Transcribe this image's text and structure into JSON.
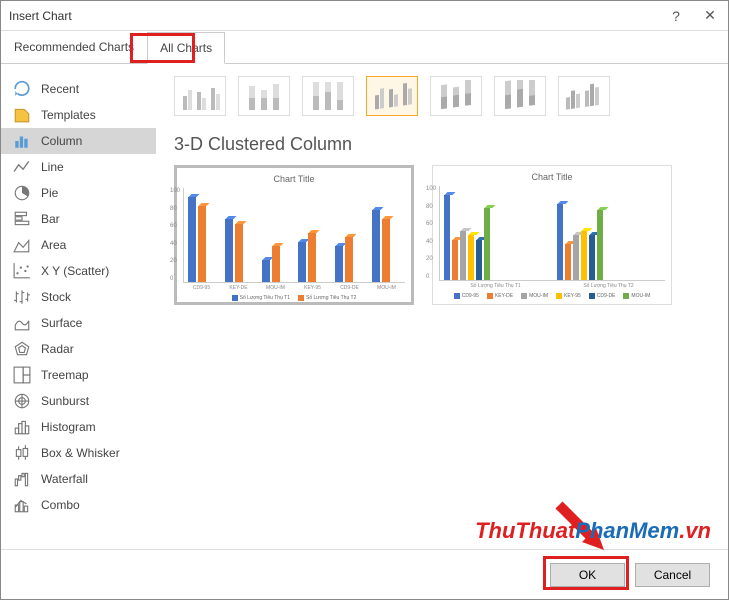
{
  "dialog": {
    "title": "Insert Chart"
  },
  "tabs": {
    "recommended": "Recommended Charts",
    "all": "All Charts"
  },
  "sidebar": {
    "items": [
      {
        "label": "Recent"
      },
      {
        "label": "Templates"
      },
      {
        "label": "Column"
      },
      {
        "label": "Line"
      },
      {
        "label": "Pie"
      },
      {
        "label": "Bar"
      },
      {
        "label": "Area"
      },
      {
        "label": "X Y (Scatter)"
      },
      {
        "label": "Stock"
      },
      {
        "label": "Surface"
      },
      {
        "label": "Radar"
      },
      {
        "label": "Treemap"
      },
      {
        "label": "Sunburst"
      },
      {
        "label": "Histogram"
      },
      {
        "label": "Box & Whisker"
      },
      {
        "label": "Waterfall"
      },
      {
        "label": "Combo"
      }
    ]
  },
  "main": {
    "chart_type_title": "3-D Clustered Column",
    "preview1_title": "Chart Title",
    "preview2_title": "Chart Title",
    "p1_categories": [
      "CD9-95",
      "KEY-DE",
      "MOU-IM",
      "KEY-95",
      "CD9-DE",
      "MOU-IM"
    ],
    "p1_legend": [
      "Số Lượng Tiêu Thụ T1",
      "Số Lượng Tiêu Thụ T2"
    ],
    "p2_categories": [
      "Số Lượng Tiêu Thụ T1",
      "Số Lượng Tiêu Thụ T2"
    ],
    "p2_legend": [
      "CD9-95",
      "KEY-DE",
      "MOU-IM",
      "KEY-95",
      "CD9-DE",
      "MOU-IM"
    ]
  },
  "footer": {
    "ok": "OK",
    "cancel": "Cancel"
  },
  "watermark": {
    "part1": "ThuThuat",
    "part2": "PhanMem",
    "part3": ".vn"
  },
  "chart_data": [
    {
      "type": "bar",
      "title": "Chart Title",
      "categories": [
        "CD9-95",
        "KEY-DE",
        "MOU-IM",
        "KEY-95",
        "CD9-DE",
        "MOU-IM"
      ],
      "series": [
        {
          "name": "Số Lượng Tiêu Thụ T1",
          "values": [
            95,
            70,
            25,
            45,
            40,
            80
          ],
          "color": "#4472c4"
        },
        {
          "name": "Số Lượng Tiêu Thụ T2",
          "values": [
            85,
            65,
            40,
            55,
            50,
            70
          ],
          "color": "#ed7d31"
        }
      ],
      "ylim": [
        0,
        100
      ],
      "yticks": [
        0,
        20,
        40,
        60,
        80,
        100
      ]
    },
    {
      "type": "bar",
      "title": "Chart Title",
      "categories": [
        "Số Lượng Tiêu Thụ T1",
        "Số Lượng Tiêu Thụ T2"
      ],
      "series": [
        {
          "name": "CD9-95",
          "values": [
            95,
            85
          ],
          "color": "#4472c4"
        },
        {
          "name": "KEY-DE",
          "values": [
            45,
            40
          ],
          "color": "#ed7d31"
        },
        {
          "name": "MOU-IM",
          "values": [
            55,
            50
          ],
          "color": "#a5a5a5"
        },
        {
          "name": "KEY-95",
          "values": [
            50,
            55
          ],
          "color": "#ffc000"
        },
        {
          "name": "CD9-DE",
          "values": [
            45,
            50
          ],
          "color": "#255e91"
        },
        {
          "name": "MOU-IM",
          "values": [
            80,
            78
          ],
          "color": "#70ad47"
        }
      ],
      "ylim": [
        0,
        100
      ],
      "yticks": [
        0,
        20,
        40,
        60,
        80,
        100
      ]
    }
  ]
}
